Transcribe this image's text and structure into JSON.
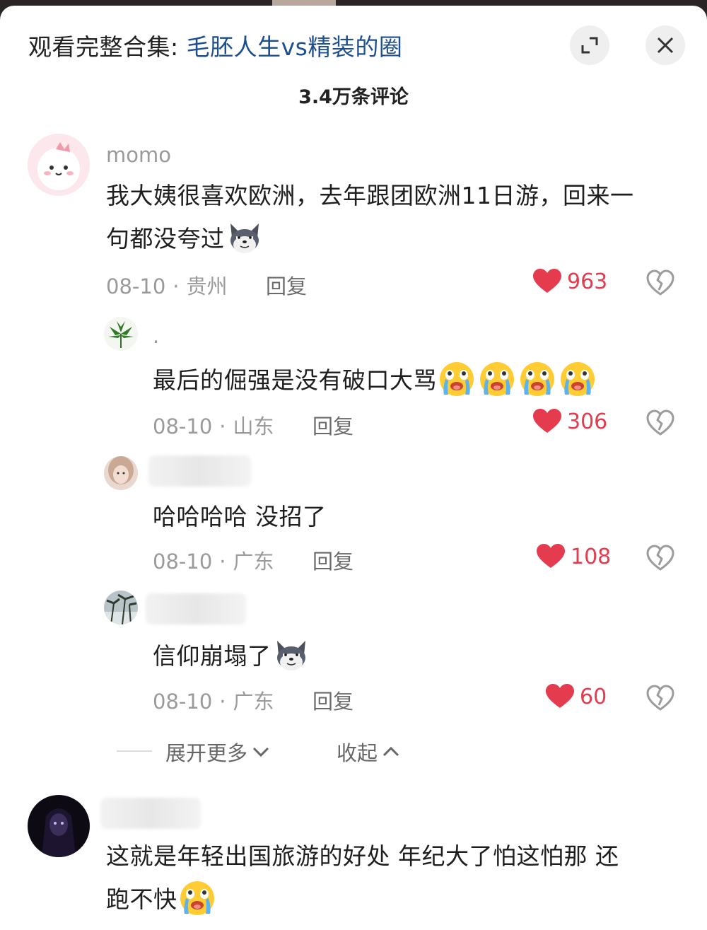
{
  "header": {
    "title_prefix": "观看完整合集: ",
    "title_link": "毛胚人生vs精装的圈",
    "comment_count": "3.4万条评论"
  },
  "comments": [
    {
      "username": "momo",
      "text": "我大姨很喜欢欧洲，去年跟团欧洲11日游，回来一句都没夸过",
      "text_line1": "我大姨很喜欢欧洲，去年跟团欧洲11日游，回来一",
      "text_line2": "句都没夸过",
      "emojis": [
        "sly-wolf-emoji"
      ],
      "date": "08-10",
      "location": "贵州",
      "reply": "回复",
      "likes": "963"
    },
    {
      "username": ".",
      "text": "最后的倔强是没有破口大骂",
      "emojis": [
        "crying-face-emoji",
        "crying-face-emoji",
        "crying-face-emoji",
        "crying-face-emoji"
      ],
      "date": "08-10",
      "location": "山东",
      "reply": "回复",
      "likes": "306"
    },
    {
      "username": "",
      "text": "哈哈哈哈 没招了",
      "date": "08-10",
      "location": "广东",
      "reply": "回复",
      "likes": "108"
    },
    {
      "username": "",
      "text": "信仰崩塌了",
      "emojis": [
        "sly-wolf-emoji"
      ],
      "date": "08-10",
      "location": "广东",
      "reply": "回复",
      "likes": "60"
    },
    {
      "username": "",
      "text_line1": "这就是年轻出国旅游的好处 年纪大了怕这怕那 还",
      "text_line2": "跑不快",
      "emojis": [
        "crying-face-emoji"
      ]
    }
  ],
  "thread": {
    "expand_more": "展开更多",
    "collapse": "收起"
  },
  "colors": {
    "like_red": "#e43b4e",
    "link_blue": "#1d4f8f",
    "meta_gray": "#9a9a9a"
  }
}
